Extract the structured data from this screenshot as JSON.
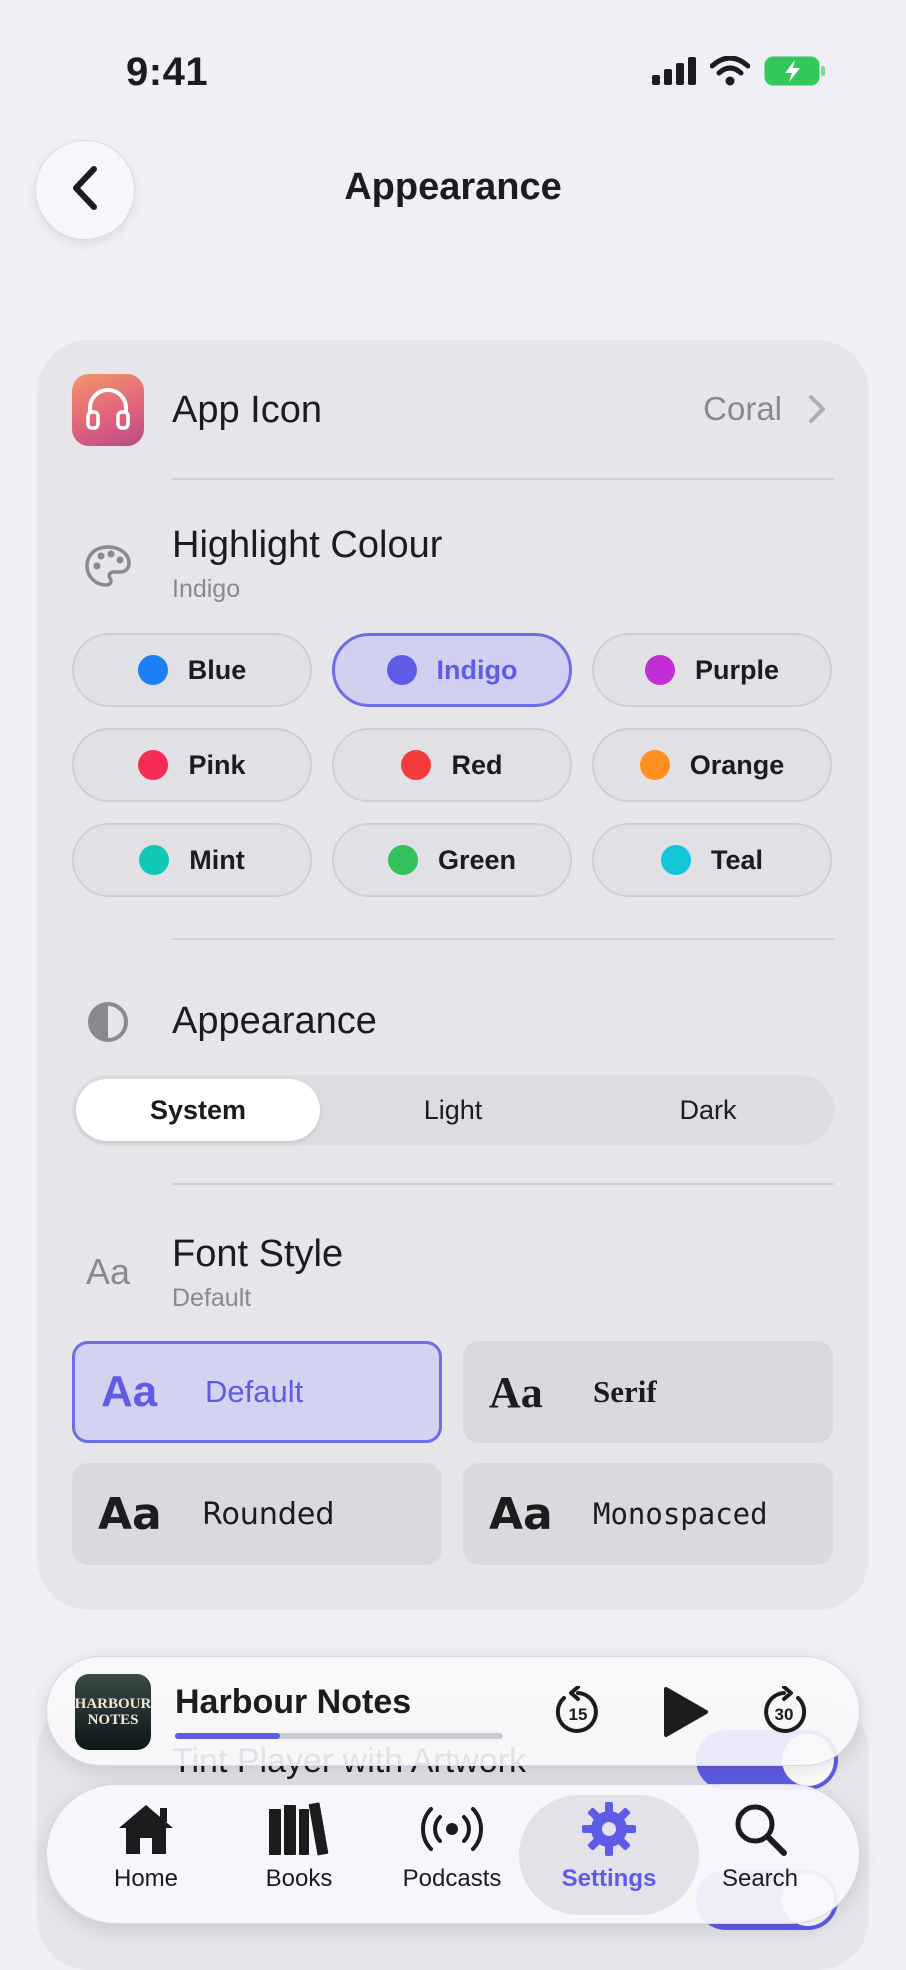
{
  "status_bar": {
    "time": "9:41"
  },
  "nav": {
    "title": "Appearance"
  },
  "app_icon": {
    "label": "App Icon",
    "value": "Coral"
  },
  "highlight": {
    "label": "Highlight Colour",
    "value": "Indigo",
    "colors": [
      {
        "name": "Blue",
        "hex": "#1e7ff5"
      },
      {
        "name": "Indigo",
        "hex": "#5e5ce6"
      },
      {
        "name": "Purple",
        "hex": "#c22ed6"
      },
      {
        "name": "Pink",
        "hex": "#f52d56"
      },
      {
        "name": "Red",
        "hex": "#f53a3a"
      },
      {
        "name": "Orange",
        "hex": "#ff8f1f"
      },
      {
        "name": "Mint",
        "hex": "#10c9b4"
      },
      {
        "name": "Green",
        "hex": "#34c15a"
      },
      {
        "name": "Teal",
        "hex": "#14c4d9"
      }
    ]
  },
  "appearance": {
    "label": "Appearance",
    "options": [
      "System",
      "Light",
      "Dark"
    ],
    "selected": "System"
  },
  "font_style": {
    "label": "Font Style",
    "value": "Default",
    "options": [
      {
        "name": "Default",
        "sample": "Aa"
      },
      {
        "name": "Serif",
        "sample": "Aa"
      },
      {
        "name": "Rounded",
        "sample": "Aa"
      },
      {
        "name": "Monospaced",
        "sample": "Aa"
      }
    ]
  },
  "hidden_rows": {
    "tint_player": "Tint Player with Artwork"
  },
  "player": {
    "title": "Harbour Notes",
    "artwork_text": [
      "HARBOUR",
      "NOTES"
    ],
    "progress": 0.32,
    "skip_back": "15",
    "skip_forward": "30"
  },
  "tabs": [
    {
      "label": "Home",
      "icon": "home-icon"
    },
    {
      "label": "Books",
      "icon": "books-icon"
    },
    {
      "label": "Podcasts",
      "icon": "podcasts-icon"
    },
    {
      "label": "Settings",
      "icon": "settings-icon"
    },
    {
      "label": "Search",
      "icon": "search-icon"
    }
  ],
  "accent_color": "#5e5ce6"
}
